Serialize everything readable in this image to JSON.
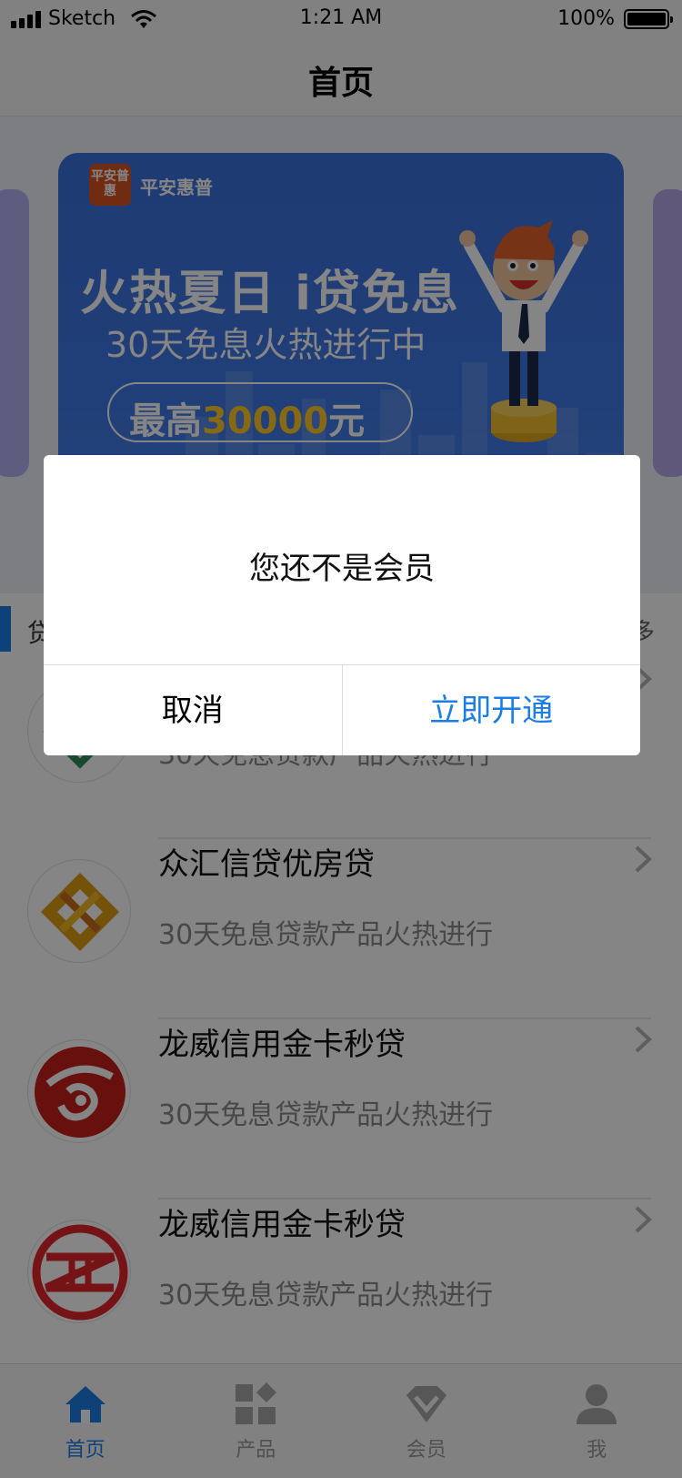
{
  "status_bar": {
    "carrier": "Sketch",
    "time": "1:21 AM",
    "battery": "100%",
    "icons": [
      "signal-icon",
      "wifi-icon",
      "battery-icon"
    ]
  },
  "nav": {
    "title": "首页"
  },
  "banner": {
    "logo_mark": "平安普惠",
    "brand": "平安惠普",
    "headline": "火热夏日 i贷免息",
    "subline": "30天免息火热进行中",
    "pill_prefix": "最高",
    "pill_amount": "30000",
    "pill_suffix": "元"
  },
  "section": {
    "title": "贷",
    "more": "多"
  },
  "products": [
    {
      "name": "",
      "desc": "30天免息贷款产品火热进行",
      "logo": "diamond-logo-icon"
    },
    {
      "name": "众汇信贷优房贷",
      "desc": "30天免息贷款产品火热进行",
      "logo": "chain-logo-icon"
    },
    {
      "name": "龙威信用金卡秒贷",
      "desc": "30天免息贷款产品火热进行",
      "logo": "swirl-logo-icon"
    },
    {
      "name": "龙威信用金卡秒贷",
      "desc": "30天免息贷款产品火热进行",
      "logo": "zh-logo-icon"
    }
  ],
  "tabs": [
    {
      "label": "首页",
      "icon": "home-icon",
      "active": true
    },
    {
      "label": "产品",
      "icon": "grid-icon",
      "active": false
    },
    {
      "label": "会员",
      "icon": "diamond-icon",
      "active": false
    },
    {
      "label": "我",
      "icon": "user-icon",
      "active": false
    }
  ],
  "dialog": {
    "message": "您还不是会员",
    "cancel": "取消",
    "confirm": "立即开通"
  },
  "colors": {
    "accent": "#1a7ee6",
    "banner_blue": "#3f78e6",
    "overlay": "rgba(0,0,0,0.48)"
  }
}
